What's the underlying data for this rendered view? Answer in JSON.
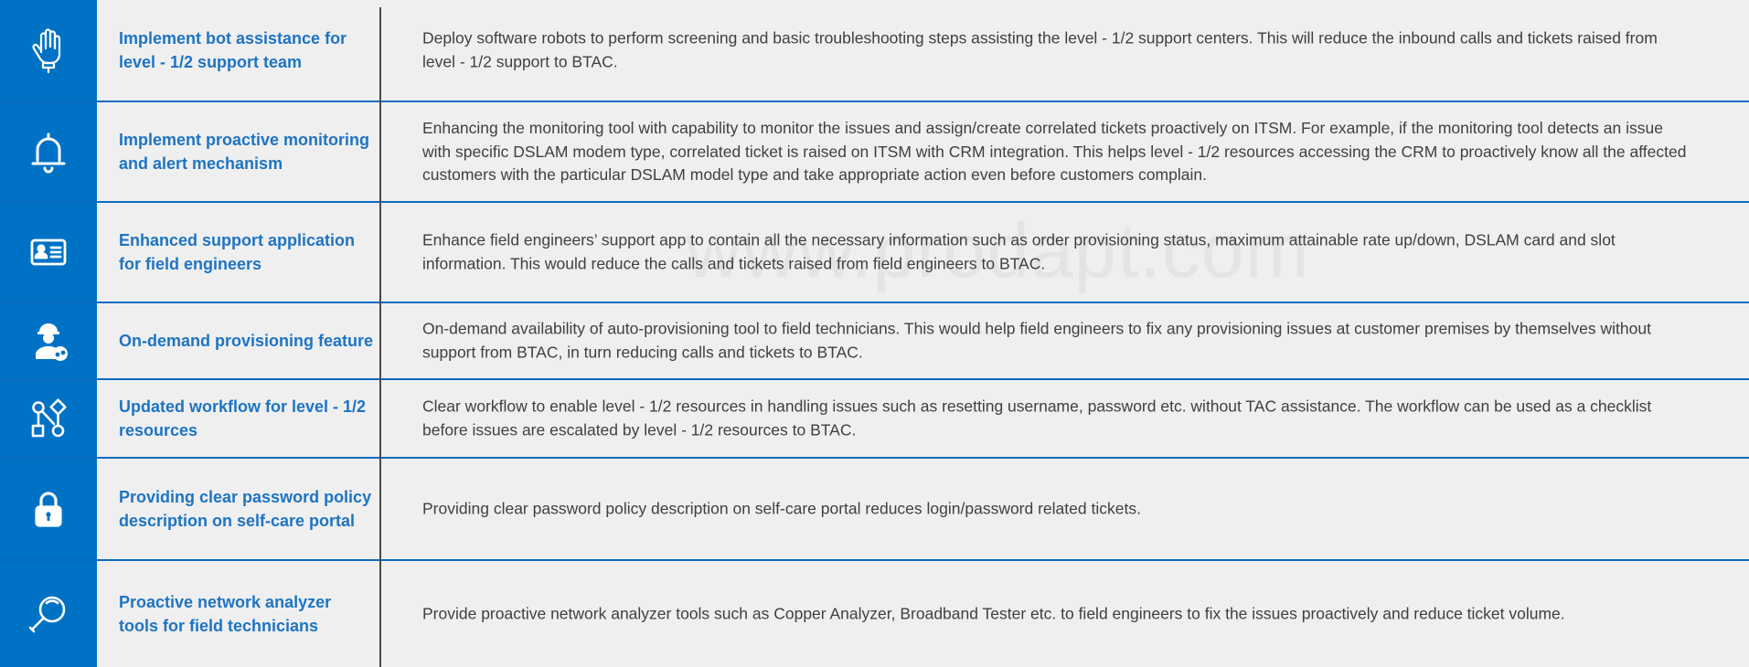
{
  "watermark": "www.prodapt.com",
  "rows": [
    {
      "icon": "robot-hand-icon",
      "title": "Implement bot assistance for level - 1/2 support team",
      "description": "Deploy software robots to perform screening and basic troubleshooting steps assisting the level - 1/2 support centers. This will reduce the inbound calls and tickets raised from level - 1/2 support to BTAC."
    },
    {
      "icon": "bell-icon",
      "title": "Implement proactive monitoring and alert mechanism",
      "description": "Enhancing the monitoring tool with capability to monitor the issues and assign/create correlated tickets proactively on ITSM.  For example, if the monitoring tool detects an issue with specific DSLAM modem type, correlated ticket is raised on ITSM with CRM integration. This helps level - 1/2 resources accessing the CRM to proactively know all the affected customers with the particular DSLAM model type and take appropriate action even before customers complain."
    },
    {
      "icon": "id-card-icon",
      "title": "Enhanced support application for field engineers",
      "description": "Enhance field engineers’ support app to contain all the necessary information such as order provisioning status, maximum attainable rate up/down, DSLAM card and slot information. This would reduce the calls and tickets raised from field engineers to BTAC."
    },
    {
      "icon": "engineer-gear-icon",
      "title": "On-demand provisioning feature",
      "description": "On-demand availability of auto-provisioning tool to field technicians. This would help field engineers to fix any provisioning issues at customer premises by themselves without support from BTAC, in turn reducing calls and tickets to BTAC."
    },
    {
      "icon": "workflow-icon",
      "title": "Updated workflow for level - 1/2 resources",
      "description": "Clear workflow to enable level - 1/2 resources in handling issues such as resetting username, password etc. without TAC assistance. The workflow can be used as a checklist before issues are escalated by level - 1/2 resources to BTAC."
    },
    {
      "icon": "padlock-icon",
      "title": "Providing clear password policy description on self-care portal",
      "description": "Providing clear password policy description on self-care portal reduces login/password related tickets."
    },
    {
      "icon": "magnifier-icon",
      "title": "Proactive network analyzer tools for field technicians",
      "description": "Provide proactive network analyzer tools such as Copper Analyzer, Broadband Tester etc. to field engineers to fix the issues proactively and reduce ticket volume."
    }
  ]
}
